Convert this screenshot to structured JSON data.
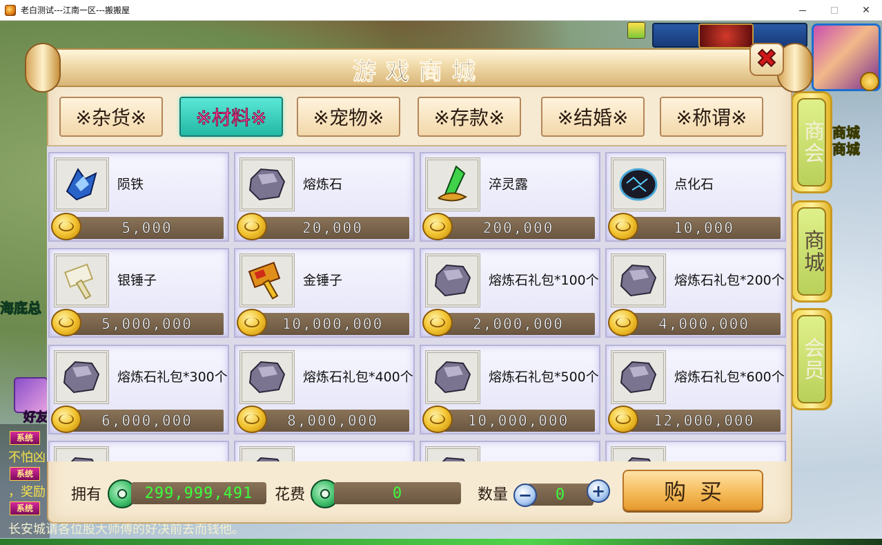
{
  "window": {
    "title": "老白测试---江南一区---搬搬屋"
  },
  "scene": {
    "right_labels": [
      "商城",
      "商城"
    ],
    "left_label": "海底总",
    "npc_label": "好友",
    "chat": [
      {
        "tag": "系统",
        "text": "不怕凶"
      },
      {
        "tag": "系统",
        "text": "，奖励"
      },
      {
        "tag": "系统",
        "text": ""
      }
    ],
    "chat_bottom": "长安城请各位股大师傅的好决前去而钱他。"
  },
  "side_tabs": [
    {
      "label": "商会"
    },
    {
      "label": "商城"
    },
    {
      "label": "会员"
    }
  ],
  "dialog": {
    "title": "游戏商城",
    "close_symbol": "✖"
  },
  "categories": [
    {
      "label": "※杂货※",
      "active": false
    },
    {
      "label": "※材料※",
      "active": true
    },
    {
      "label": "※宠物※",
      "active": false
    },
    {
      "label": "※存款※",
      "active": false
    },
    {
      "label": "※结婚※",
      "active": false
    },
    {
      "label": "※称谓※",
      "active": false
    }
  ],
  "items": [
    {
      "name": "陨铁",
      "price": "5,000",
      "icon": "meteor-iron-icon"
    },
    {
      "name": "熔炼石",
      "price": "20,000",
      "icon": "smelting-stone-icon"
    },
    {
      "name": "淬灵露",
      "price": "200,000",
      "icon": "green-crystal-icon"
    },
    {
      "name": "点化石",
      "price": "10,000",
      "icon": "dark-orb-icon"
    },
    {
      "name": "银锤子",
      "price": "5,000,000",
      "icon": "silver-hammer-icon"
    },
    {
      "name": "金锤子",
      "price": "10,000,000",
      "icon": "gold-hammer-icon"
    },
    {
      "name": "熔炼石礼包*100个",
      "price": "2,000,000",
      "icon": "smelting-stone-icon"
    },
    {
      "name": "熔炼石礼包*200个",
      "price": "4,000,000",
      "icon": "smelting-stone-icon"
    },
    {
      "name": "熔炼石礼包*300个",
      "price": "6,000,000",
      "icon": "smelting-stone-icon"
    },
    {
      "name": "熔炼石礼包*400个",
      "price": "8,000,000",
      "icon": "smelting-stone-icon"
    },
    {
      "name": "熔炼石礼包*500个",
      "price": "10,000,000",
      "icon": "smelting-stone-icon"
    },
    {
      "name": "熔炼石礼包*600个",
      "price": "12,000,000",
      "icon": "smelting-stone-icon"
    },
    {
      "name": "",
      "price": "",
      "icon": "smelting-stone-icon"
    },
    {
      "name": "",
      "price": "",
      "icon": "smelting-stone-icon"
    },
    {
      "name": "",
      "price": "",
      "icon": "smelting-stone-icon"
    },
    {
      "name": "",
      "price": "",
      "icon": "smelting-stone-icon"
    }
  ],
  "footer": {
    "owned_label": "拥有",
    "owned_value": "299,999,491",
    "cost_label": "花费",
    "cost_value": "0",
    "qty_label": "数量",
    "qty_value": "0",
    "minus": "−",
    "plus": "+",
    "buy_label": "购买"
  },
  "colors": {
    "active_tab": "#22b8a4",
    "price_text": "#ffffff",
    "currency_text": "#3cff3c"
  }
}
